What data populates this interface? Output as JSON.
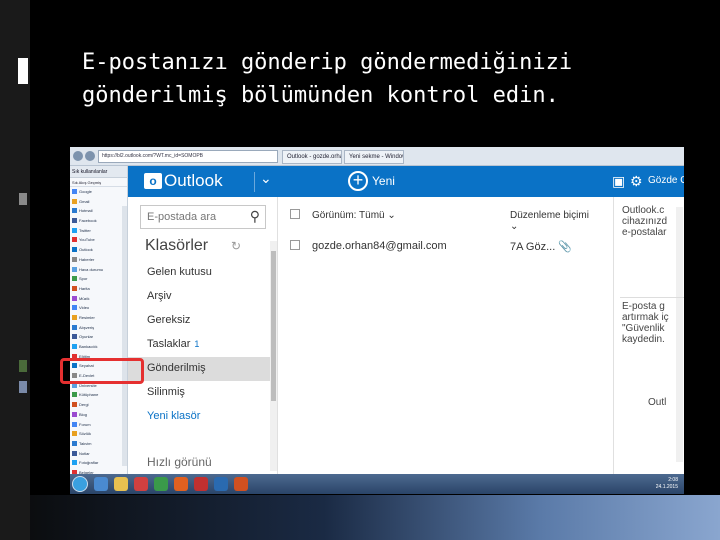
{
  "slide": {
    "title_line1": "E-postanızı gönderip göndermediğinizi",
    "title_line2": "gönderilmiş bölümünden kontrol edin."
  },
  "browser": {
    "url": "https://bl2.outlook.com/?WT.mc_id=SOMOPB",
    "tab1": "Outlook - gozde.orhan84@...",
    "tab2": "Yeni sekme - Windows"
  },
  "favorites": {
    "header": "Sık kullanılanlar",
    "tabs": "Sık  Akış  Geçmiş",
    "items": [
      "Google",
      "Gmail",
      "Hotmail",
      "Facebook",
      "Twitter",
      "YouTube",
      "Outlook",
      "Haberler",
      "Hava durumu",
      "Spor",
      "Harita",
      "Müzik",
      "Video",
      "Resimler",
      "Alışveriş",
      "Oyunlar",
      "Bankacılık",
      "Eğitim",
      "Seyahat",
      "E-Devlet",
      "Üniversite",
      "Kütüphane",
      "Dergi",
      "Blog",
      "Forum",
      "Sözlük",
      "Takvim",
      "Notlar",
      "Fotoğraflar",
      "Belgeler",
      "Ayarlar"
    ]
  },
  "outlook": {
    "brand": "Outlook",
    "new_label": "Yeni",
    "user": "Gözde O",
    "search_placeholder": "E-postada ara",
    "folders_heading": "Klasörler",
    "folders": [
      {
        "label": "Gelen kutusu",
        "count": ""
      },
      {
        "label": "Arşiv",
        "count": ""
      },
      {
        "label": "Gereksiz",
        "count": ""
      },
      {
        "label": "Taslaklar",
        "count": "1"
      },
      {
        "label": "Gönderilmiş",
        "count": ""
      },
      {
        "label": "Silinmiş",
        "count": ""
      }
    ],
    "new_folder": "Yeni klasör",
    "quick_views": "Hızlı görünü",
    "toolbar_view": "Görünüm: Tümü",
    "toolbar_sort": "Düzenleme biçimi",
    "message": {
      "from": "gozde.orhan84@gmail.com",
      "time": "7A Göz..."
    },
    "reading_pane": {
      "line1": "Outlook.c",
      "line2": "cihazınızd",
      "line3": "e-postalar",
      "line4": "E-posta g",
      "line5": "artırmak iç",
      "line6": "\"Güvenlik",
      "line7": "kaydedin.",
      "line8": "Outl"
    }
  },
  "taskbar": {
    "time": "2:08",
    "date": "24.1.2015"
  },
  "colors": {
    "outlook_blue": "#0a72c6",
    "highlight_red": "#e53030"
  }
}
